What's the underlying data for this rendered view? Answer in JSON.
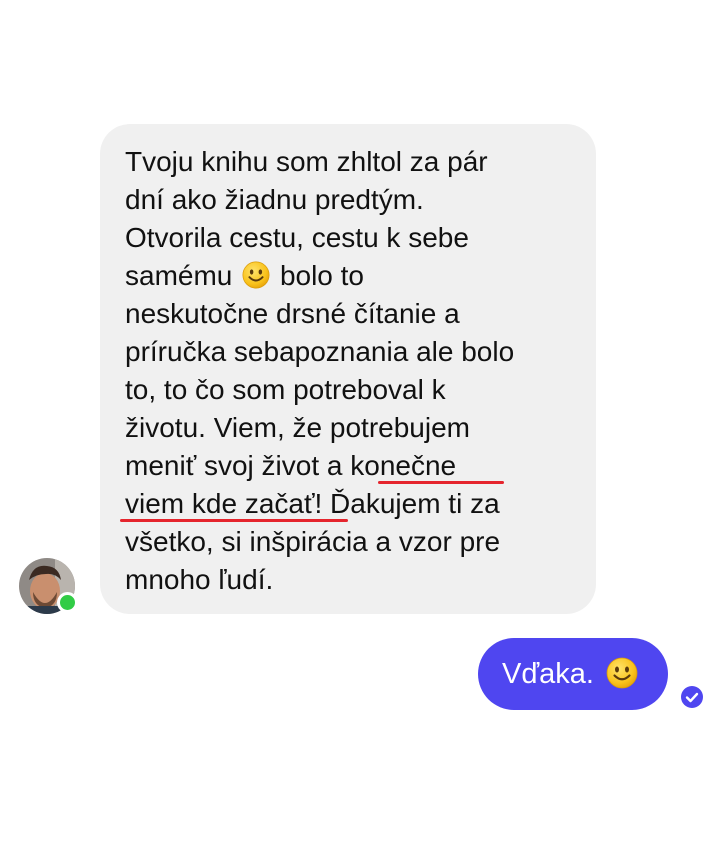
{
  "conversation": {
    "incoming_message": {
      "lines": [
        "Tvoju knihu som zhltol za pár",
        "dní ako žiadnu predtým.",
        "Otvorila cestu, cestu k sebe",
        "samému",
        "bolo to",
        "neskutočne drsné čítanie a",
        "príručka sebapoznania ale bolo",
        "to, to čo som potreboval k",
        "životu. Viem, že potrebujem",
        "meniť svoj život a",
        "konečne",
        "viem kde začať!",
        "Ďakujem ti za",
        "všetko, si inšpirácia a vzor pre",
        "mnoho ľudí."
      ],
      "emoji": "slightly-smiling-face-icon",
      "highlight_color": "#e5252d"
    },
    "outgoing_message": {
      "text": "Vďaka.",
      "emoji": "slightly-smiling-face-icon"
    },
    "sender": {
      "status": "online",
      "status_color": "#31cc46"
    },
    "colors": {
      "incoming_bubble": "#f0f0f0",
      "outgoing_bubble": "#4f46f0",
      "read_receipt": "#4f46f0"
    }
  }
}
